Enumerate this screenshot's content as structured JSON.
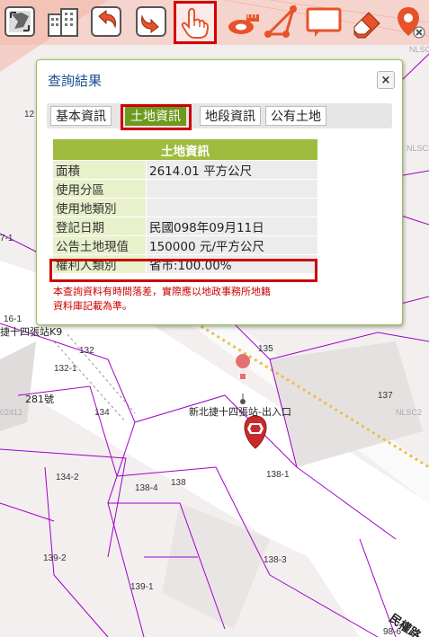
{
  "toolbar": {
    "items": [
      {
        "name": "full-extent",
        "icon": "full-extent-icon"
      },
      {
        "name": "buildings",
        "icon": "buildings-icon"
      },
      {
        "name": "undo",
        "icon": "undo-arrow-icon"
      },
      {
        "name": "redo",
        "icon": "redo-arrow-icon"
      },
      {
        "name": "identify",
        "icon": "hand-pointer-icon",
        "active": true
      },
      {
        "name": "measure-distance",
        "icon": "ruler-icon"
      },
      {
        "name": "measure-area",
        "icon": "triangle-area-icon"
      },
      {
        "name": "text-note",
        "icon": "speech-box-icon"
      },
      {
        "name": "eraser",
        "icon": "eraser-icon"
      },
      {
        "name": "locate",
        "icon": "location-pin-icon"
      }
    ],
    "accent": "#e8522a",
    "active_border": "#d40000"
  },
  "dialog": {
    "title": "查詢結果",
    "close_label": "×",
    "tabs": [
      {
        "label": "基本資訊",
        "active": false
      },
      {
        "label": "土地資訊",
        "active": true
      },
      {
        "label": "地段資訊",
        "active": false
      },
      {
        "label": "公有土地",
        "active": false
      }
    ],
    "table": {
      "header": "土地資訊",
      "rows": [
        {
          "label": "面積",
          "value": "2614.01 平方公尺"
        },
        {
          "label": "使用分區",
          "value": ""
        },
        {
          "label": "使用地類別",
          "value": ""
        },
        {
          "label": "登記日期",
          "value": "民國098年09月11日"
        },
        {
          "label": "公告土地現值",
          "value": "150000 元/平方公尺"
        },
        {
          "label": "權利人類別",
          "value": "省市:100.00%"
        }
      ]
    },
    "notice_line1": "本查詢資料有時間落差，實際應以地政事務所地籍",
    "notice_line2": "資料庫記載為準。"
  },
  "map": {
    "parcel_labels": [
      "12",
      "7-1",
      "16-1",
      "132",
      "132-1",
      "134",
      "135",
      "137",
      "138-1",
      "138-4",
      "138",
      "134-2",
      "138-3",
      "139-2",
      "139-1",
      "98-6",
      "281號"
    ],
    "station_label": "新北捷十四張站-出入口",
    "street_label_partial": "捷十四張站K9",
    "road_label": "民權路",
    "nlsc_tags": [
      "NLSC2",
      "NLSC2",
      "NLSC2",
      "02412"
    ],
    "marker_color": "#d63a3a"
  }
}
